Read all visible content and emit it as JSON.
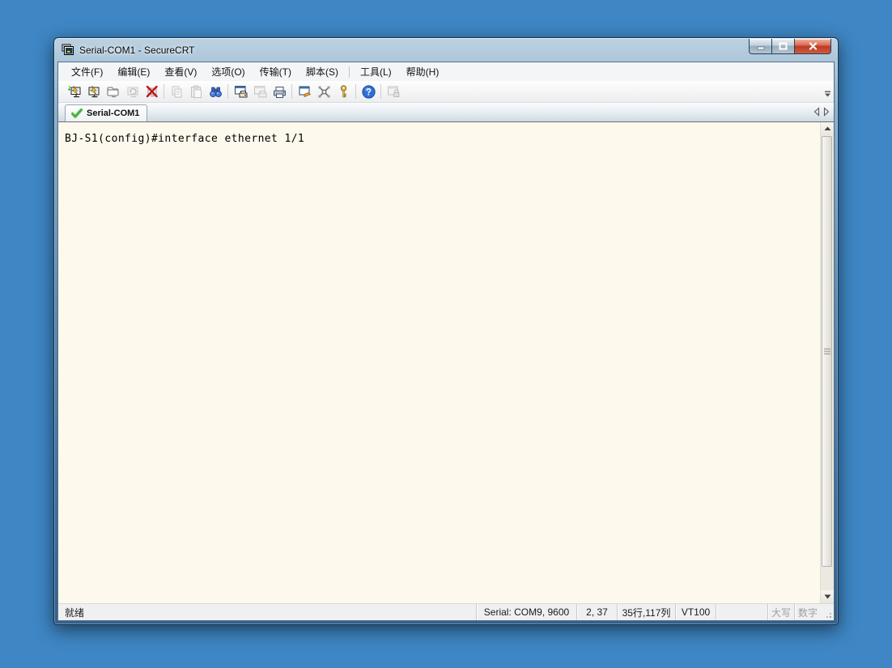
{
  "window": {
    "title": "Serial-COM1 - SecureCRT",
    "app_icon": "securecrt-app-icon",
    "buttons": [
      "minimize",
      "restore",
      "close"
    ]
  },
  "menu": {
    "items": [
      {
        "label": "文件(F)"
      },
      {
        "label": "编辑(E)"
      },
      {
        "label": "查看(V)"
      },
      {
        "label": "选项(O)"
      },
      {
        "label": "传输(T)"
      },
      {
        "label": "脚本(S)"
      },
      {
        "label": "工具(L)"
      },
      {
        "label": "帮助(H)"
      }
    ]
  },
  "toolbar": {
    "items": [
      {
        "name": "quick-connect",
        "enabled": true
      },
      {
        "name": "connect",
        "enabled": true
      },
      {
        "name": "connect-in-tab",
        "enabled": true
      },
      {
        "name": "reconnect",
        "enabled": false
      },
      {
        "name": "disconnect",
        "enabled": true
      },
      {
        "name": "copy",
        "enabled": false
      },
      {
        "name": "paste",
        "enabled": false
      },
      {
        "name": "find",
        "enabled": true
      },
      {
        "name": "print-screen",
        "enabled": true
      },
      {
        "name": "print-selection",
        "enabled": false
      },
      {
        "name": "print",
        "enabled": true
      },
      {
        "name": "session-options",
        "enabled": true
      },
      {
        "name": "keymap-editor",
        "enabled": true
      },
      {
        "name": "manage-keys",
        "enabled": true
      },
      {
        "name": "help",
        "enabled": true
      },
      {
        "name": "secure-session-lock",
        "enabled": false
      }
    ],
    "overflow_icon": "toolbar-overflow-chevron"
  },
  "tabstrip": {
    "tabs": [
      {
        "label": "Serial-COM1",
        "icon": "session-connected-check"
      }
    ],
    "nav_icons": [
      "tab-scroll-left",
      "tab-scroll-right"
    ]
  },
  "terminal": {
    "lines": [
      "BJ-S1(config)#interface ethernet 1/1"
    ],
    "bg": "#FDF9EC",
    "fg": "#000000"
  },
  "statusbar": {
    "ready": "就绪",
    "serial": "Serial: COM9, 9600",
    "cursor_position": "2, 37",
    "grid_size": "35行,117列",
    "emulation": "VT100",
    "caps_lock": "大写",
    "num_lock": "数字"
  },
  "colors": {
    "desktop": "#3E86C4",
    "titlebar_blue": "#35618C",
    "terminal_bg": "#FDF9EC",
    "terminal_fg": "#000000",
    "close_button_red": "#BB3A24",
    "tab_check_green": "#3FAE3F"
  }
}
